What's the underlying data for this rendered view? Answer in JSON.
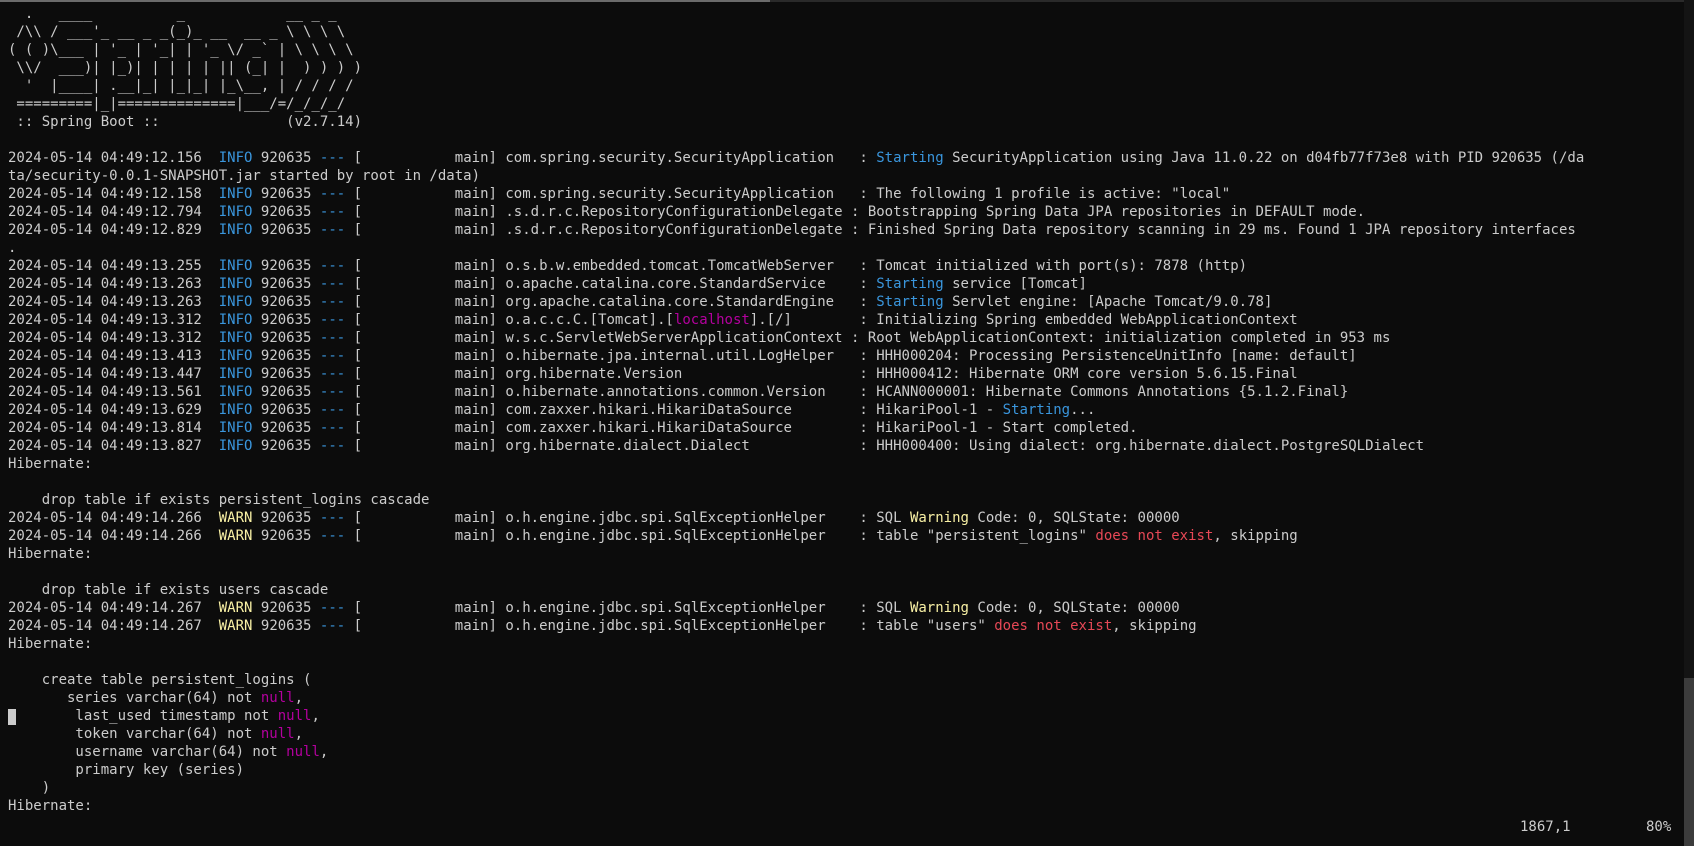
{
  "banner": [
    "  .   ____          _            __ _ _",
    " /\\\\ / ___'_ __ _ _(_)_ __  __ _ \\ \\ \\ \\",
    "( ( )\\___ | '_ | '_| | '_ \\/ _` | \\ \\ \\ \\",
    " \\\\/  ___)| |_)| | | | | || (_| |  ) ) ) )",
    "  '  |____| .__|_| |_|_| |_\\__, | / / / /",
    " =========|_|==============|___/=/_/_/_/",
    " :: Spring Boot ::               (v2.7.14)"
  ],
  "log_lines": [
    {
      "ts": "2024-05-14 04:49:12.156",
      "level": "INFO",
      "pid": "920635",
      "thread": "main",
      "logger": "com.spring.security.SecurityApplication  ",
      "pre": "",
      "hl": "Starting",
      "hlc": "cyan",
      "post": " SecurityApplication using Java 11.0.22 on d04fb77f73e8 with PID 920635 (/da"
    },
    {
      "cont": "ta/security-0.0.1-SNAPSHOT.jar started by root in /data)"
    },
    {
      "ts": "2024-05-14 04:49:12.158",
      "level": "INFO",
      "pid": "920635",
      "thread": "main",
      "logger": "com.spring.security.SecurityApplication  ",
      "pre": "The following 1 profile is active: \"local\"",
      "hl": "",
      "hlc": "",
      "post": ""
    },
    {
      "ts": "2024-05-14 04:49:12.794",
      "level": "INFO",
      "pid": "920635",
      "thread": "main",
      "logger": ".s.d.r.c.RepositoryConfigurationDelegate",
      "pre": "Bootstrapping Spring Data JPA repositories in DEFAULT mode.",
      "hl": "",
      "hlc": "",
      "post": ""
    },
    {
      "ts": "2024-05-14 04:49:12.829",
      "level": "INFO",
      "pid": "920635",
      "thread": "main",
      "logger": ".s.d.r.c.RepositoryConfigurationDelegate",
      "pre": "Finished Spring Data repository scanning in 29 ms. Found 1 JPA repository interfaces",
      "hl": "",
      "hlc": "",
      "post": ""
    },
    {
      "cont": "."
    },
    {
      "ts": "2024-05-14 04:49:13.255",
      "level": "INFO",
      "pid": "920635",
      "thread": "main",
      "logger": "o.s.b.w.embedded.tomcat.TomcatWebServer  ",
      "pre": "Tomcat initialized with port(s): 7878 (http)",
      "hl": "",
      "hlc": "",
      "post": ""
    },
    {
      "ts": "2024-05-14 04:49:13.263",
      "level": "INFO",
      "pid": "920635",
      "thread": "main",
      "logger": "o.apache.catalina.core.StandardService   ",
      "pre": "",
      "hl": "Starting",
      "hlc": "cyan",
      "post": " service [Tomcat]"
    },
    {
      "ts": "2024-05-14 04:49:13.263",
      "level": "INFO",
      "pid": "920635",
      "thread": "main",
      "logger": "org.apache.catalina.core.StandardEngine  ",
      "pre": "",
      "hl": "Starting",
      "hlc": "cyan",
      "post": " Servlet engine: [Apache Tomcat/9.0.78]"
    },
    {
      "ts": "2024-05-14 04:49:13.312",
      "level": "INFO",
      "pid": "920635",
      "thread": "main",
      "logger": "o.a.c.c.C.[Tomcat].[localhost].[/]       ",
      "logger_hl": "localhost",
      "pre": "Initializing Spring embedded WebApplicationContext",
      "hl": "",
      "hlc": "",
      "post": ""
    },
    {
      "ts": "2024-05-14 04:49:13.312",
      "level": "INFO",
      "pid": "920635",
      "thread": "main",
      "logger": "w.s.c.ServletWebServerApplicationContext",
      "pre": "Root WebApplicationContext: initialization completed in 953 ms",
      "hl": "",
      "hlc": "",
      "post": ""
    },
    {
      "ts": "2024-05-14 04:49:13.413",
      "level": "INFO",
      "pid": "920635",
      "thread": "main",
      "logger": "o.hibernate.jpa.internal.util.LogHelper  ",
      "pre": "HHH000204: Processing PersistenceUnitInfo [name: default]",
      "hl": "",
      "hlc": "",
      "post": ""
    },
    {
      "ts": "2024-05-14 04:49:13.447",
      "level": "INFO",
      "pid": "920635",
      "thread": "main",
      "logger": "org.hibernate.Version                    ",
      "pre": "HHH000412: Hibernate ORM core version 5.6.15.Final",
      "hl": "",
      "hlc": "",
      "post": ""
    },
    {
      "ts": "2024-05-14 04:49:13.561",
      "level": "INFO",
      "pid": "920635",
      "thread": "main",
      "logger": "o.hibernate.annotations.common.Version   ",
      "pre": "HCANN000001: Hibernate Commons Annotations {5.1.2.Final}",
      "hl": "",
      "hlc": "",
      "post": ""
    },
    {
      "ts": "2024-05-14 04:49:13.629",
      "level": "INFO",
      "pid": "920635",
      "thread": "main",
      "logger": "com.zaxxer.hikari.HikariDataSource       ",
      "pre": "HikariPool-1 - ",
      "hl": "Starting",
      "hlc": "cyan",
      "post": "..."
    },
    {
      "ts": "2024-05-14 04:49:13.814",
      "level": "INFO",
      "pid": "920635",
      "thread": "main",
      "logger": "com.zaxxer.hikari.HikariDataSource       ",
      "pre": "HikariPool-1 - Start completed.",
      "hl": "",
      "hlc": "",
      "post": ""
    },
    {
      "ts": "2024-05-14 04:49:13.827",
      "level": "INFO",
      "pid": "920635",
      "thread": "main",
      "logger": "org.hibernate.dialect.Dialect            ",
      "pre": "HHH000400: Using dialect: org.hibernate.dialect.PostgreSQLDialect",
      "hl": "",
      "hlc": "",
      "post": ""
    },
    {
      "cont": "Hibernate: "
    },
    {
      "cont": ""
    },
    {
      "cont": "    drop table if exists persistent_logins cascade"
    },
    {
      "ts": "2024-05-14 04:49:14.266",
      "level": "WARN",
      "pid": "920635",
      "thread": "main",
      "logger": "o.h.engine.jdbc.spi.SqlExceptionHelper   ",
      "pre": "SQL ",
      "hl": "Warning",
      "hlc": "yellow",
      "post": " Code: 0, SQLState: 00000"
    },
    {
      "ts": "2024-05-14 04:49:14.266",
      "level": "WARN",
      "pid": "920635",
      "thread": "main",
      "logger": "o.h.engine.jdbc.spi.SqlExceptionHelper   ",
      "pre": "table \"persistent_logins\" ",
      "hl": "does not exist",
      "hlc": "red",
      "post": ", skipping"
    },
    {
      "cont": "Hibernate: "
    },
    {
      "cont": ""
    },
    {
      "cont": "    drop table if exists users cascade"
    },
    {
      "ts": "2024-05-14 04:49:14.267",
      "level": "WARN",
      "pid": "920635",
      "thread": "main",
      "logger": "o.h.engine.jdbc.spi.SqlExceptionHelper   ",
      "pre": "SQL ",
      "hl": "Warning",
      "hlc": "yellow",
      "post": " Code: 0, SQLState: 00000"
    },
    {
      "ts": "2024-05-14 04:49:14.267",
      "level": "WARN",
      "pid": "920635",
      "thread": "main",
      "logger": "o.h.engine.jdbc.spi.SqlExceptionHelper   ",
      "pre": "table \"users\" ",
      "hl": "does not exist",
      "hlc": "red",
      "post": ", skipping"
    },
    {
      "cont": "Hibernate: "
    },
    {
      "cont": ""
    },
    {
      "cont": "    create table persistent_logins ("
    },
    {
      "sql": "       series varchar(64) not ",
      "kw": "null",
      "tail": ","
    },
    {
      "sql": "        last_used timestamp not ",
      "kw": "null",
      "tail": ","
    },
    {
      "sql": "        token varchar(64) not ",
      "kw": "null",
      "tail": ","
    },
    {
      "sql": "        username varchar(64) not ",
      "kw": "null",
      "tail": ","
    },
    {
      "cont": "        primary key (series)"
    },
    {
      "cont": "    )"
    },
    {
      "cont": "Hibernate: "
    }
  ],
  "status_bar": {
    "position": "1867,1",
    "percent": "80%"
  },
  "colors": {
    "background": "#0c0c0c",
    "foreground": "#cccccc",
    "info": "#3a96dd",
    "warn": "#f9f1a5",
    "error": "#e74856",
    "keyword": "#b4009e"
  }
}
